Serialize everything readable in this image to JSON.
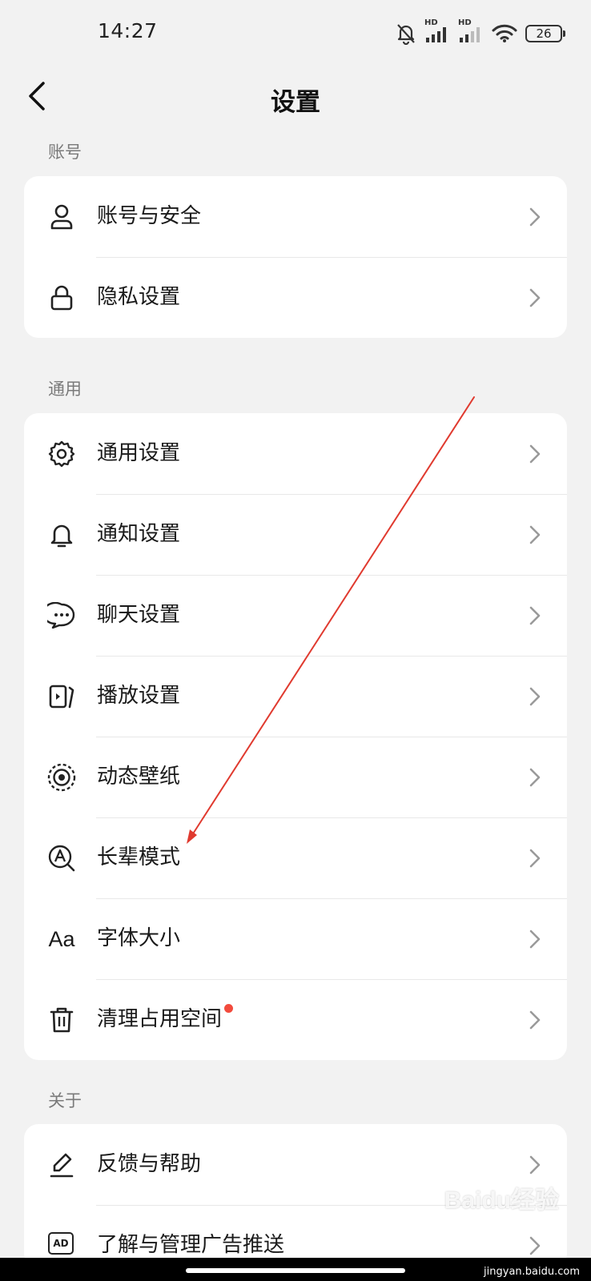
{
  "status_bar": {
    "time": "14:27",
    "signal_label_1": "HD",
    "signal_label_2": "HD",
    "battery": "26",
    "icons": [
      "bell-off-icon",
      "signal-icon",
      "signal-icon",
      "wifi-icon",
      "battery-icon"
    ]
  },
  "header": {
    "title": "设置",
    "back_icon": "chevron-left-icon"
  },
  "sections": [
    {
      "label": "账号",
      "items": [
        {
          "label": "账号与安全",
          "icon": "user-icon"
        },
        {
          "label": "隐私设置",
          "icon": "lock-icon"
        }
      ]
    },
    {
      "label": "通用",
      "items": [
        {
          "label": "通用设置",
          "icon": "gear-icon"
        },
        {
          "label": "通知设置",
          "icon": "bell-icon"
        },
        {
          "label": "聊天设置",
          "icon": "chat-bubble-icon"
        },
        {
          "label": "播放设置",
          "icon": "play-screen-icon"
        },
        {
          "label": "动态壁纸",
          "icon": "live-wallpaper-icon"
        },
        {
          "label": "长辈模式",
          "icon": "elder-mode-icon"
        },
        {
          "label": "字体大小",
          "icon": "font-size-icon",
          "icon_text": "Aa"
        },
        {
          "label": "清理占用空间",
          "icon": "trash-icon",
          "badge": "red-dot"
        }
      ]
    },
    {
      "label": "关于",
      "items": [
        {
          "label": "反馈与帮助",
          "icon": "pen-icon"
        },
        {
          "label": "了解与管理广告推送",
          "icon": "ad-icon",
          "icon_text": "AD"
        }
      ]
    }
  ],
  "watermark": "Baidu经验",
  "footer_site": "jingyan.baidu.com",
  "colors": {
    "background": "#f2f2f2",
    "card": "#ffffff",
    "annotation_arrow": "#e03a2f",
    "badge": "#f24b3d"
  }
}
